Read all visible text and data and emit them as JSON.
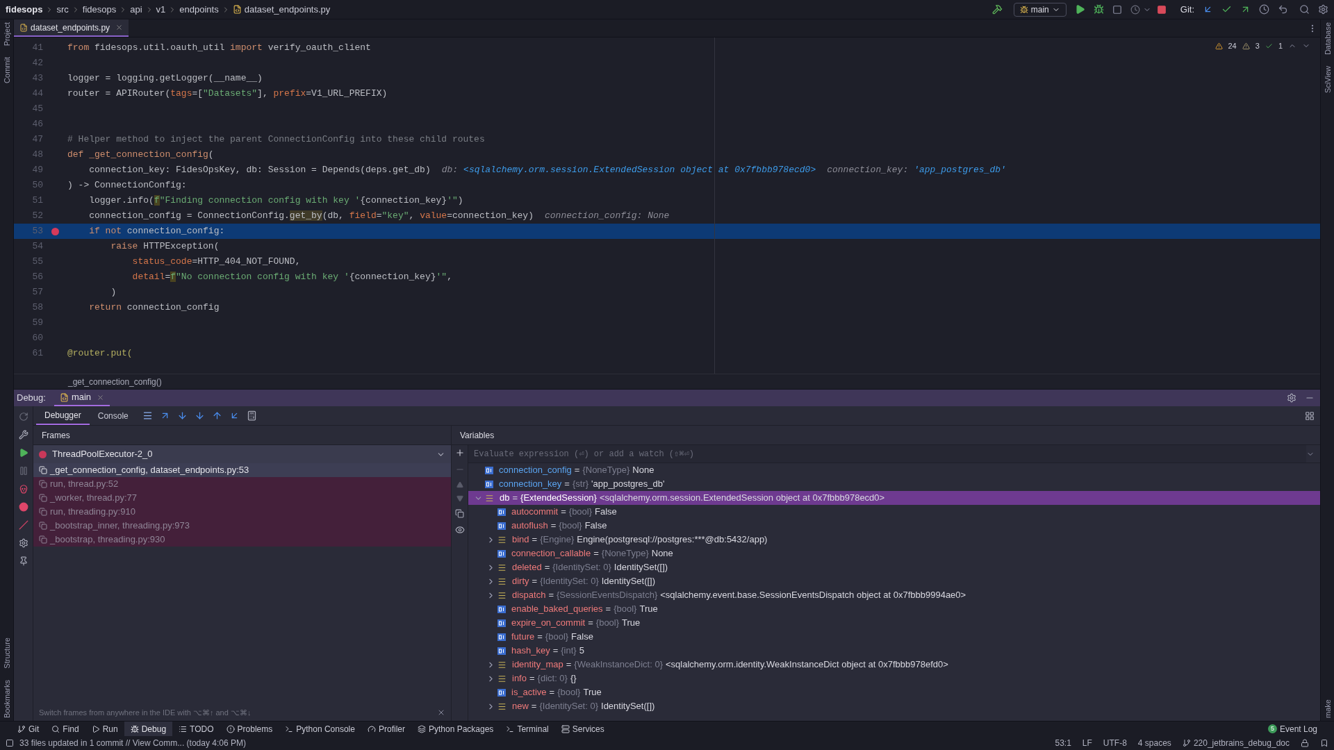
{
  "navbar": {
    "breadcrumbs": [
      {
        "label": "fidesops",
        "kind": "project"
      },
      {
        "label": "src",
        "kind": "folder"
      },
      {
        "label": "fidesops",
        "kind": "folder"
      },
      {
        "label": "api",
        "kind": "folder"
      },
      {
        "label": "v1",
        "kind": "folder"
      },
      {
        "label": "endpoints",
        "kind": "folder"
      },
      {
        "label": "dataset_endpoints.py",
        "kind": "file"
      }
    ],
    "run_config": "main",
    "git_label": "Git:"
  },
  "left_strip": {
    "top": [
      "Project",
      "Commit"
    ],
    "bottom": [
      "Structure",
      "Bookmarks"
    ]
  },
  "right_strip": {
    "top": [
      "Database",
      "SciView"
    ],
    "bottom": [
      "make"
    ]
  },
  "editor_tabs": [
    {
      "label": "dataset_endpoints.py",
      "selected": true
    }
  ],
  "inspections": {
    "warnings": "24",
    "weak_warnings": "3",
    "checks": "1"
  },
  "code_lines": [
    {
      "number": "41",
      "tokens": [
        {
          "kind": "kw",
          "text": "from"
        },
        {
          "kind": "plain",
          "text": " fidesops.util.oauth_util "
        },
        {
          "kind": "kw",
          "text": "import"
        },
        {
          "kind": "plain",
          "text": " verify_oauth_client"
        }
      ]
    },
    {
      "number": "42"
    },
    {
      "number": "43",
      "tokens": [
        {
          "kind": "plain",
          "text": "logger = logging.getLogger(__name__)"
        }
      ]
    },
    {
      "number": "44",
      "tokens": [
        {
          "kind": "plain",
          "text": "router = APIRouter("
        },
        {
          "kind": "param",
          "text": "tags"
        },
        {
          "kind": "plain",
          "text": "=["
        },
        {
          "kind": "str",
          "text": "\"Datasets\""
        },
        {
          "kind": "plain",
          "text": "], "
        },
        {
          "kind": "param",
          "text": "prefix"
        },
        {
          "kind": "plain",
          "text": "=V1_URL_PREFIX)"
        }
      ]
    },
    {
      "number": "45"
    },
    {
      "number": "46"
    },
    {
      "number": "47",
      "tokens": [
        {
          "kind": "comment",
          "text": "# Helper method to inject the parent ConnectionConfig into these child routes"
        }
      ]
    },
    {
      "number": "48",
      "tokens": [
        {
          "kind": "kw",
          "text": "def _get_connection_config"
        },
        {
          "kind": "plain",
          "text": "("
        }
      ]
    },
    {
      "number": "49",
      "tokens": [
        {
          "kind": "plain",
          "text": "    connection_key: FidesOpsKey, db: Session = Depends(deps.get_db)"
        },
        {
          "kind": "hint_label",
          "text": "db:"
        },
        {
          "kind": "hint_value",
          "text": "<sqlalchemy.orm.session.ExtendedSession object at 0x7fbbb978ecd0>"
        },
        {
          "kind": "hint_label",
          "text": "connection_key:"
        },
        {
          "kind": "hint_value",
          "text": "'app_postgres_db'"
        }
      ]
    },
    {
      "number": "50",
      "tokens": [
        {
          "kind": "plain",
          "text": ") -> ConnectionConfig:"
        }
      ]
    },
    {
      "number": "51",
      "tokens": [
        {
          "kind": "plain",
          "text": "    logger.info("
        },
        {
          "kind": "fprefix",
          "text": "f"
        },
        {
          "kind": "str",
          "text": "\"Finding connection config with key '"
        },
        {
          "kind": "plain",
          "text": "{connection_key}"
        },
        {
          "kind": "str",
          "text": "'\""
        },
        {
          "kind": "plain",
          "text": ")"
        }
      ]
    },
    {
      "number": "52",
      "tokens": [
        {
          "kind": "plain",
          "text": "    connection_config = ConnectionConfig."
        },
        {
          "kind": "match",
          "text": "get_by"
        },
        {
          "kind": "plain",
          "text": "(db, "
        },
        {
          "kind": "param",
          "text": "field"
        },
        {
          "kind": "plain",
          "text": "="
        },
        {
          "kind": "str",
          "text": "\"key\""
        },
        {
          "kind": "plain",
          "text": ", "
        },
        {
          "kind": "param",
          "text": "value"
        },
        {
          "kind": "plain",
          "text": "=connection_key)"
        },
        {
          "kind": "hint_label",
          "text": "connection_config: None"
        }
      ]
    },
    {
      "number": "53",
      "breakpoint": true,
      "current": true,
      "tokens": [
        {
          "kind": "kw",
          "text": "    if not"
        },
        {
          "kind": "plain",
          "text": " connection_config:"
        }
      ]
    },
    {
      "number": "54",
      "tokens": [
        {
          "kind": "kw",
          "text": "        raise"
        },
        {
          "kind": "plain",
          "text": " HTTPException("
        }
      ]
    },
    {
      "number": "55",
      "tokens": [
        {
          "kind": "param",
          "text": "            status_code"
        },
        {
          "kind": "plain",
          "text": "=HTTP_404_NOT_FOUND,"
        }
      ]
    },
    {
      "number": "56",
      "tokens": [
        {
          "kind": "param",
          "text": "            detail"
        },
        {
          "kind": "plain",
          "text": "="
        },
        {
          "kind": "fprefix",
          "text": "f"
        },
        {
          "kind": "str",
          "text": "\"No connection config with key '"
        },
        {
          "kind": "plain",
          "text": "{connection_key}"
        },
        {
          "kind": "str",
          "text": "'\""
        },
        {
          "kind": "plain",
          "text": ","
        }
      ]
    },
    {
      "number": "57",
      "tokens": [
        {
          "kind": "plain",
          "text": "        )"
        }
      ]
    },
    {
      "number": "58",
      "tokens": [
        {
          "kind": "kw",
          "text": "    return"
        },
        {
          "kind": "plain",
          "text": " connection_config"
        }
      ]
    },
    {
      "number": "59"
    },
    {
      "number": "60"
    },
    {
      "number": "61",
      "tokens": [
        {
          "kind": "deco",
          "text": "@router.put("
        }
      ]
    }
  ],
  "editor_breadcrumb": "_get_connection_config()",
  "debug": {
    "label": "Debug:",
    "tabs": [
      {
        "label": "main",
        "selected": true
      }
    ],
    "subtabs": [
      {
        "label": "Debugger",
        "selected": true
      },
      {
        "label": "Console",
        "selected": false
      }
    ],
    "frames_title": "Frames",
    "thread": "ThreadPoolExecutor-2_0",
    "frames": [
      {
        "label": "_get_connection_config, dataset_endpoints.py:53",
        "kind": "user",
        "selected": true
      },
      {
        "label": "run, thread.py:52",
        "kind": "library",
        "selected": false
      },
      {
        "label": "_worker, thread.py:77",
        "kind": "library",
        "selected": false
      },
      {
        "label": "run, threading.py:910",
        "kind": "library",
        "selected": false
      },
      {
        "label": "_bootstrap_inner, threading.py:973",
        "kind": "library",
        "selected": false
      },
      {
        "label": "_bootstrap, threading.py:930",
        "kind": "library",
        "selected": false
      }
    ],
    "frames_hint": "Switch frames from anywhere in the IDE with ⌥⌘↑ and ⌥⌘↓",
    "variables_title": "Variables",
    "watch_placeholder": "Evaluate expression (⏎) or add a watch (⇧⌘⏎)",
    "variables": [
      {
        "name": "connection_config",
        "sep": "=",
        "type": "{NoneType}",
        "value": "None",
        "kind": "primitive",
        "selected": false
      },
      {
        "name": "connection_key",
        "sep": "=",
        "type": "{str}",
        "value": "'app_postgres_db'",
        "kind": "primitive",
        "selected": false
      },
      {
        "name": "db",
        "sep": "=",
        "type": "{ExtendedSession}",
        "value": "<sqlalchemy.orm.session.ExtendedSession object at 0x7fbbb978ecd0>",
        "kind": "object",
        "expanded": true,
        "selected": true,
        "children": [
          {
            "name": "autocommit",
            "sep": "=",
            "type": "{bool}",
            "value": "False",
            "kind": "primitive",
            "selected": false
          },
          {
            "name": "autoflush",
            "sep": "=",
            "type": "{bool}",
            "value": "False",
            "kind": "primitive",
            "selected": false
          },
          {
            "name": "bind",
            "sep": "=",
            "type": "{Engine}",
            "value": "Engine(postgresql://postgres:***@db:5432/app)",
            "kind": "object",
            "expanded": false,
            "selected": false
          },
          {
            "name": "connection_callable",
            "sep": "=",
            "type": "{NoneType}",
            "value": "None",
            "kind": "primitive",
            "selected": false
          },
          {
            "name": "deleted",
            "sep": "=",
            "type": "{IdentitySet: 0}",
            "value": "IdentitySet([])",
            "kind": "object",
            "expanded": false,
            "selected": false
          },
          {
            "name": "dirty",
            "sep": "=",
            "type": "{IdentitySet: 0}",
            "value": "IdentitySet([])",
            "kind": "object",
            "expanded": false,
            "selected": false
          },
          {
            "name": "dispatch",
            "sep": "=",
            "type": "{SessionEventsDispatch}",
            "value": "<sqlalchemy.event.base.SessionEventsDispatch object at 0x7fbbb9994ae0>",
            "kind": "object",
            "expanded": false,
            "selected": false
          },
          {
            "name": "enable_baked_queries",
            "sep": "=",
            "type": "{bool}",
            "value": "True",
            "kind": "primitive",
            "selected": false
          },
          {
            "name": "expire_on_commit",
            "sep": "=",
            "type": "{bool}",
            "value": "True",
            "kind": "primitive",
            "selected": false
          },
          {
            "name": "future",
            "sep": "=",
            "type": "{bool}",
            "value": "False",
            "kind": "primitive",
            "selected": false
          },
          {
            "name": "hash_key",
            "sep": "=",
            "type": "{int}",
            "value": "5",
            "kind": "primitive",
            "selected": false
          },
          {
            "name": "identity_map",
            "sep": "=",
            "type": "{WeakInstanceDict: 0}",
            "value": "<sqlalchemy.orm.identity.WeakInstanceDict object at 0x7fbbb978efd0>",
            "kind": "object",
            "expanded": false,
            "selected": false
          },
          {
            "name": "info",
            "sep": "=",
            "type": "{dict: 0}",
            "value": "{}",
            "kind": "object",
            "expanded": false,
            "selected": false
          },
          {
            "name": "is_active",
            "sep": "=",
            "type": "{bool}",
            "value": "True",
            "kind": "primitive",
            "selected": false
          },
          {
            "name": "new",
            "sep": "=",
            "type": "{IdentitySet: 0}",
            "value": "IdentitySet([])",
            "kind": "object",
            "expanded": false,
            "selected": false
          }
        ]
      }
    ]
  },
  "tool_windows": [
    {
      "label": "Git",
      "kind": "git",
      "selected": false
    },
    {
      "label": "Find",
      "kind": "find",
      "selected": false
    },
    {
      "label": "Run",
      "kind": "run",
      "selected": false
    },
    {
      "label": "Debug",
      "kind": "debug",
      "selected": true
    },
    {
      "label": "TODO",
      "kind": "todo",
      "selected": false
    },
    {
      "label": "Problems",
      "kind": "problems",
      "selected": false
    },
    {
      "label": "Python Console",
      "kind": "console",
      "selected": false
    },
    {
      "label": "Profiler",
      "kind": "profiler",
      "selected": false
    },
    {
      "label": "Python Packages",
      "kind": "packages",
      "selected": false
    },
    {
      "label": "Terminal",
      "kind": "terminal",
      "selected": false
    },
    {
      "label": "Services",
      "kind": "services",
      "selected": false
    }
  ],
  "event_log": {
    "label": "Event Log",
    "count": "5"
  },
  "status_bar": {
    "message": "33 files updated in 1 commit // View Comm... (today 4:06 PM)",
    "position": "53:1",
    "line_sep": "LF",
    "encoding": "UTF-8",
    "indent": "4 spaces",
    "branch": "220_jetbrains_debug_doc"
  }
}
